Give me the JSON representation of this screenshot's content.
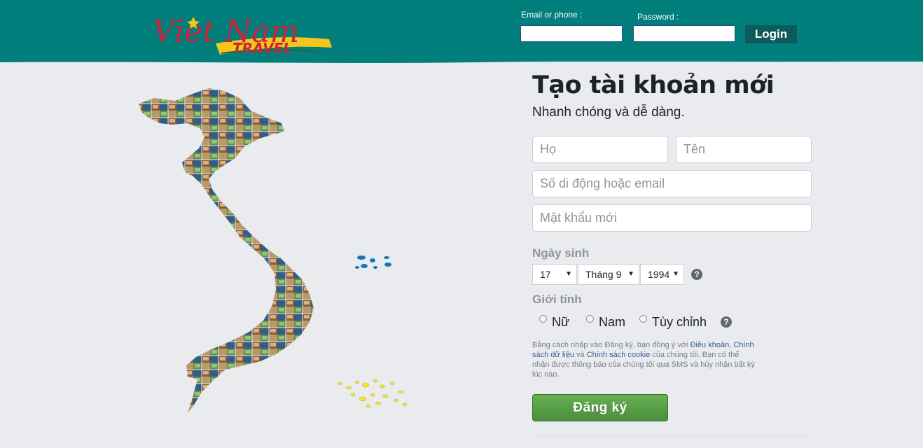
{
  "header": {
    "brand_top": "Viet Nam",
    "brand_bottom": "TRAVEL",
    "email_label": "Email or phone :",
    "email_value": "",
    "password_label": "Password :",
    "password_value": "",
    "login_label": "Login"
  },
  "signup": {
    "title": "Tạo tài khoản mới",
    "subtitle": "Nhanh chóng và dễ dàng.",
    "first_name_placeholder": "Họ",
    "last_name_placeholder": "Tên",
    "contact_placeholder": "Số di động hoặc email",
    "password_placeholder": "Mật khẩu mới",
    "birthday_label": "Ngày sinh",
    "day_value": "17",
    "month_value": "Tháng 9",
    "year_value": "1994",
    "help_glyph": "?",
    "gender_label": "Giới tính",
    "gender_options": [
      "Nữ",
      "Nam",
      "Tùy chỉnh"
    ],
    "terms_1": "Bằng cách nhấp vào Đăng ký, bạn đồng ý với ",
    "terms_link_1": "Điều khoản",
    "terms_2": ", ",
    "terms_link_2": "Chính sách dữ liệu",
    "terms_3": " và ",
    "terms_link_3": "Chính sách cookie",
    "terms_4": " của chúng tôi. Bạn có thể nhận được thông báo của chúng tôi qua SMS và hủy nhận bất kỳ lúc nào.",
    "submit_label": "Đăng ký"
  },
  "colors": {
    "header_bg": "#007f7d",
    "brand_red": "#c8243a",
    "brand_yellow": "#f6c51b",
    "signup_green": "#5aa048",
    "page_bg": "#e9ebee",
    "island_blue": "#1677b8",
    "island_yellow": "#f2e632"
  }
}
